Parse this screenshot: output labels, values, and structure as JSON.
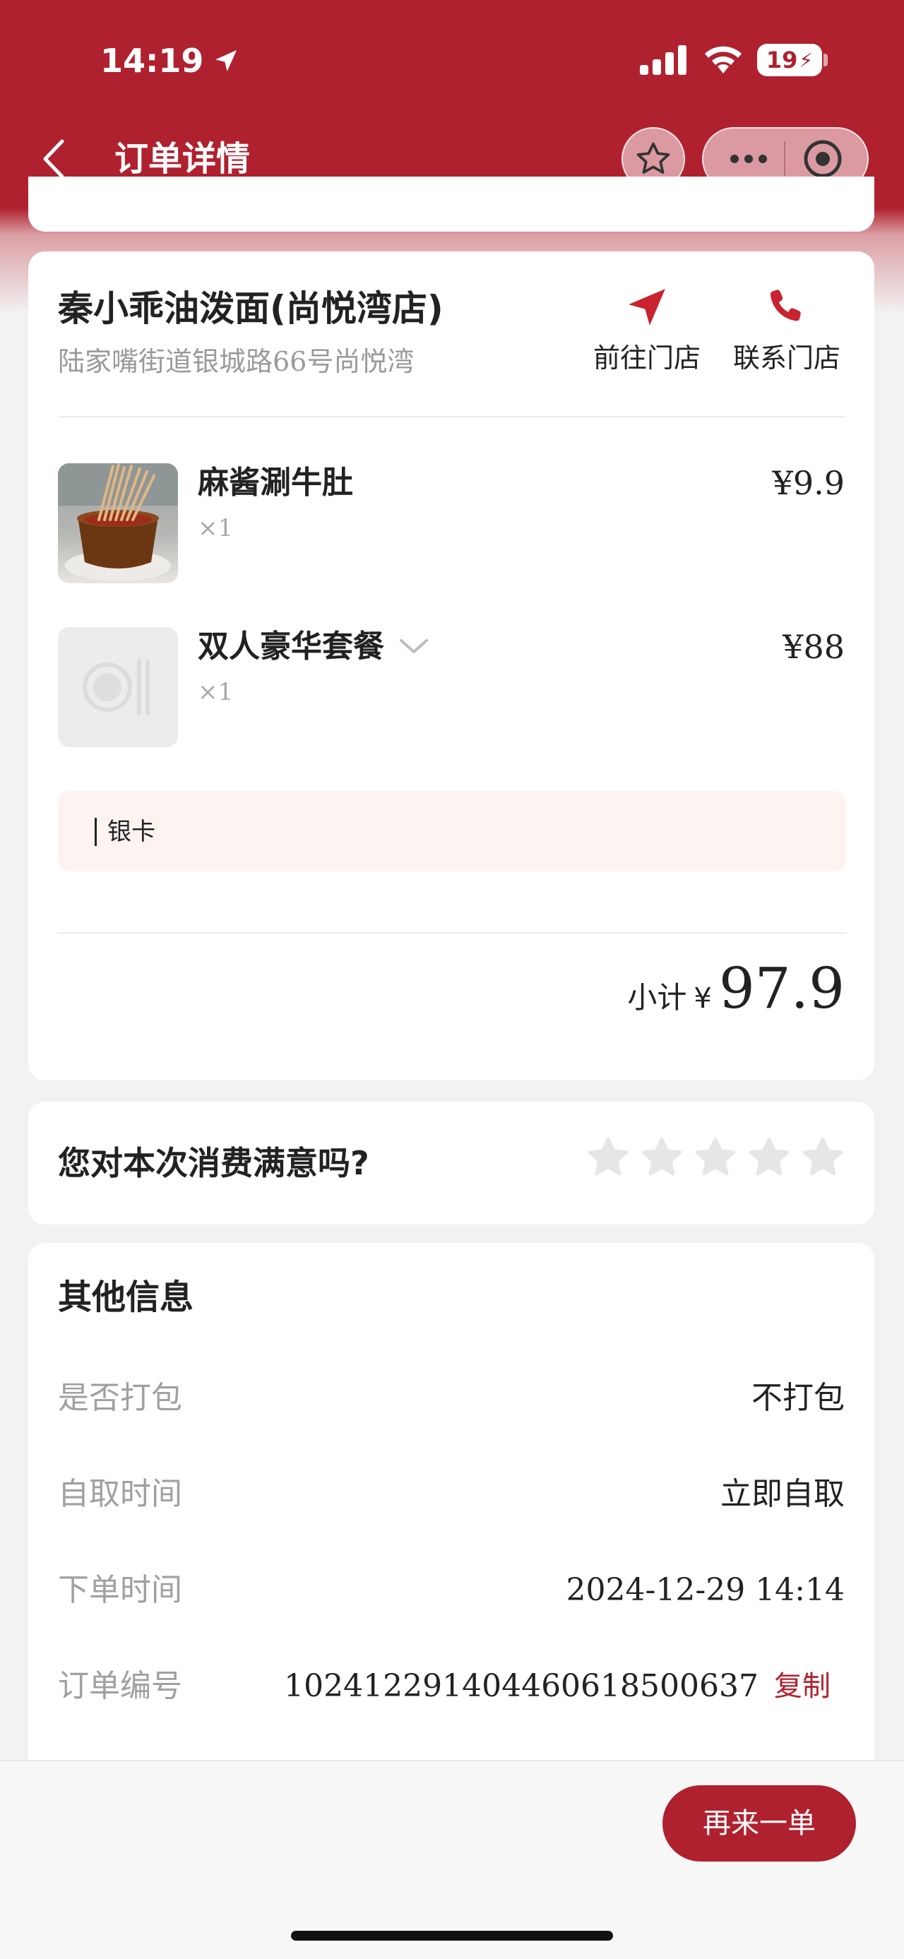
{
  "status_bar": {
    "time": "14:19",
    "battery": "19"
  },
  "header": {
    "title": "订单详情"
  },
  "store": {
    "name": "秦小乖油泼面(尚悦湾店)",
    "address": "陆家嘴街道银城路66号尚悦湾",
    "go_label": "前往门店",
    "call_label": "联系门店"
  },
  "items": [
    {
      "name": "麻酱涮牛肚",
      "qty": "×1",
      "price": "¥9.9"
    },
    {
      "name": "双人豪华套餐",
      "qty": "×1",
      "price": "¥88"
    }
  ],
  "bank_note": "银卡",
  "subtotal": {
    "label": "小计",
    "currency": "¥",
    "value": "97.9"
  },
  "rating": {
    "question": "您对本次消费满意吗?",
    "stars": 0,
    "max_stars": 5
  },
  "other_info": {
    "title": "其他信息",
    "rows": [
      {
        "label": "是否打包",
        "value": "不打包"
      },
      {
        "label": "自取时间",
        "value": "立即自取"
      },
      {
        "label": "下单时间",
        "value": "2024-12-29 14:14"
      },
      {
        "label": "订单编号",
        "value": "10241229140446061850063​7"
      }
    ],
    "copy_label": "复制"
  },
  "bottom": {
    "reorder_label": "再来一单"
  },
  "colors": {
    "brand": "#b0212f",
    "background": "#f2f2f2",
    "muted_text": "#a0a0a0"
  }
}
